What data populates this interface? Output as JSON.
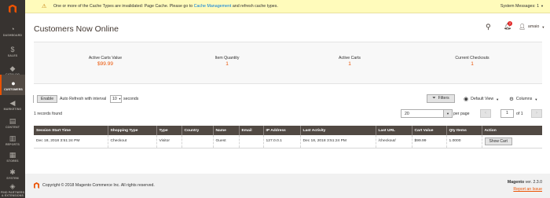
{
  "sidebar": {
    "items": [
      {
        "label": "DASHBOARD",
        "icon": "speedometer-icon",
        "glyph": "◔"
      },
      {
        "label": "SALES",
        "icon": "dollar-icon",
        "glyph": "$"
      },
      {
        "label": "CATALOG",
        "icon": "cube-icon",
        "glyph": "◆"
      },
      {
        "label": "CUSTOMERS",
        "icon": "person-icon",
        "glyph": "●",
        "active": true
      },
      {
        "label": "MARKETING",
        "icon": "megaphone-icon",
        "glyph": "◀"
      },
      {
        "label": "CONTENT",
        "icon": "content-icon",
        "glyph": "▤"
      },
      {
        "label": "REPORTS",
        "icon": "bar-chart-icon",
        "glyph": "▥"
      },
      {
        "label": "STORES",
        "icon": "store-icon",
        "glyph": "▦"
      },
      {
        "label": "SYSTEM",
        "icon": "gear-icon",
        "glyph": "✱"
      },
      {
        "label": "FIND PARTNERS & EXTENSIONS",
        "icon": "puzzle-icon",
        "glyph": "◈"
      }
    ]
  },
  "notice": {
    "text": "One or more of the Cache Types are invalidated: Page Cache. Please go to",
    "link": "Cache Management",
    "text_after": "and refresh cache types.",
    "system_messages": "System Messages: 1"
  },
  "header": {
    "title": "Customers Now Online",
    "notification_count": "2",
    "user": "amaio"
  },
  "stats": [
    {
      "label": "Active Carts Value",
      "value": "$99.99"
    },
    {
      "label": "Item Quantity",
      "value": "1"
    },
    {
      "label": "Active Carts",
      "value": "1"
    },
    {
      "label": "Current Checkouts",
      "value": "1"
    }
  ],
  "toolbar": {
    "enable_label": "Enable",
    "auto_refresh_label": "Auto Refresh with interval",
    "interval_value": "10",
    "seconds_label": "seconds",
    "filters_label": "Filters",
    "view_label": "Default View",
    "columns_label": "Columns",
    "records_found": "1 records found",
    "per_page_value": "20",
    "per_page_label": "per page",
    "current_page": "1",
    "page_of": "of 1"
  },
  "table": {
    "headers": [
      "Session Start Time",
      "Shopping Type",
      "Type",
      "Country",
      "Name",
      "Email",
      "IP Address",
      "Last Activity",
      "Last URL",
      "Cart Value",
      "Qty Items",
      "Action"
    ],
    "rows": [
      [
        "Dec 18, 2018 3:51:24 PM",
        "Checkout",
        "Visitor",
        "",
        "Guest",
        "",
        "127.0.0.1",
        "Dec 18, 2018 3:51:24 PM",
        "/checkout/",
        "$99.99",
        "1.0000",
        "Show Cart"
      ]
    ]
  },
  "footer": {
    "copyright": "Copyright © 2018 Magento Commerce Inc. All rights reserved.",
    "brand": "Magento",
    "version": "ver. 2.3.0",
    "report_link": "Report an Issue"
  },
  "colors": {
    "sidebar_bg": "#373330",
    "accent": "#eb5202",
    "table_header_bg": "#514943",
    "notice_bg": "#fffbbb"
  }
}
